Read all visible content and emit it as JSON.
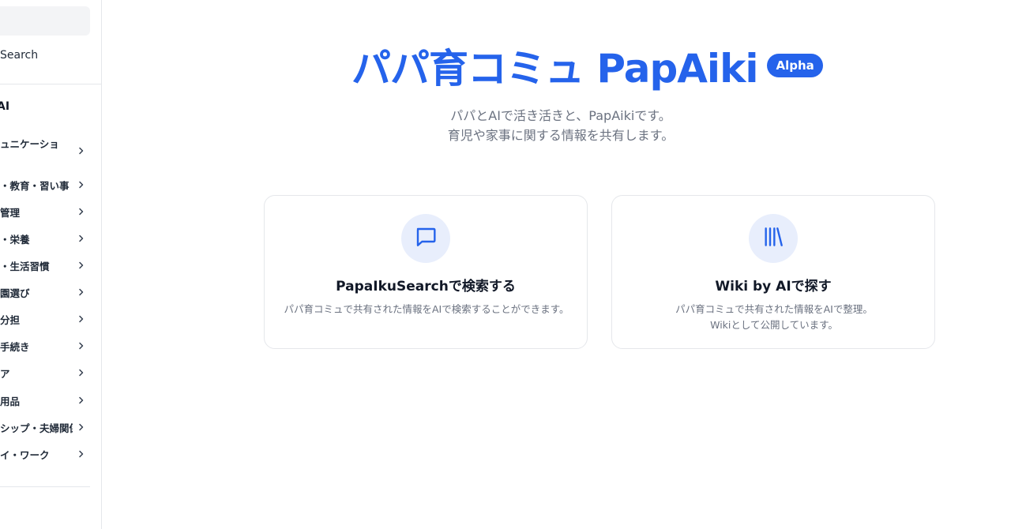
{
  "sidebar": {
    "search_label": "Search",
    "section_label": "AI",
    "items": [
      {
        "label": "ュニケーショ",
        "top": 0
      },
      {
        "label": "・教育・習い事"
      },
      {
        "label": "管理"
      },
      {
        "label": "・栄養"
      },
      {
        "label": "・生活習慣"
      },
      {
        "label": "園選び"
      },
      {
        "label": "分担"
      },
      {
        "label": "手続き"
      },
      {
        "label": "ア"
      },
      {
        "label": "用品"
      },
      {
        "label": "シップ・夫婦関係"
      },
      {
        "label": "イ・ワーク"
      }
    ]
  },
  "hero": {
    "title": "パパ育コミュ PapAiki",
    "badge": "Alpha",
    "subtitle_line1": "パパとAIで活き活きと、PapAikiです。",
    "subtitle_line2": "育児や家事に関する情報を共有します。"
  },
  "cards": [
    {
      "icon": "chat-bubble-icon",
      "title": "PapaIkuSearchで検索する",
      "description": "パパ育コミュで共有された情報をAIで検索することができます。"
    },
    {
      "icon": "library-icon",
      "title": "Wiki by AIで探す",
      "description_line1": "パパ育コミュで共有された情報をAIで整理。",
      "description_line2": "Wikiとして公開しています。"
    }
  ],
  "colors": {
    "accent": "#2563eb",
    "icon_bg": "#e8eefc",
    "muted_text": "#6b7280",
    "border": "#e5e7eb"
  }
}
